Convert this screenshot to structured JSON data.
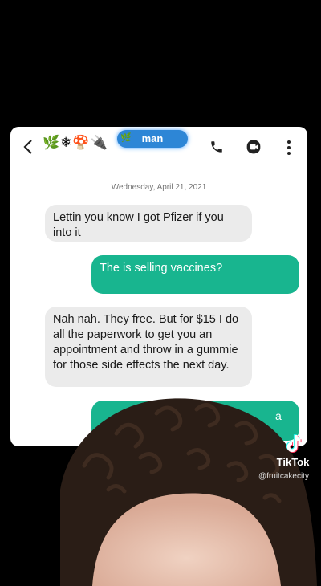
{
  "header": {
    "contact_emojis": "🌿❄🍄🔌",
    "back_icon": "chevron-left-icon",
    "call_icon": "phone-icon",
    "video_icon": "video-icon",
    "menu_icon": "kebab-icon"
  },
  "conversation": {
    "date": "Wednesday, April 21, 2021",
    "messages": [
      {
        "direction": "incoming",
        "text": "Lettin you know I got Pfizer if you into it"
      },
      {
        "direction": "outgoing",
        "text": "The            is selling vaccines?"
      },
      {
        "direction": "incoming",
        "text": "Nah nah. They free. But for $15 I do all the paperwork to get you an appointment and throw in a gummie for those side effects the next day."
      },
      {
        "direction": "outgoing",
        "text": "a"
      }
    ],
    "redaction_label": "man"
  },
  "overlay": {
    "brand": "TikTok",
    "username": "@fruitcakecity"
  },
  "colors": {
    "outgoing_bubble": "#18b58f",
    "incoming_bubble": "#ebebeb",
    "background": "#000000"
  }
}
